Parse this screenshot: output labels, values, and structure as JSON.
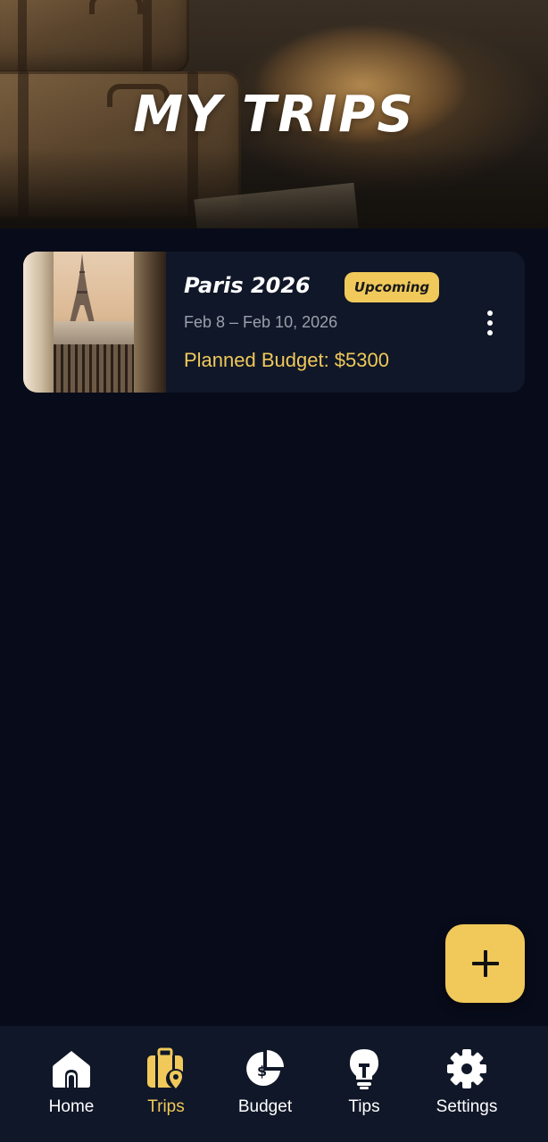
{
  "header": {
    "title": "MY TRIPS"
  },
  "trips": [
    {
      "title": "Paris 2026",
      "status": "Upcoming",
      "dates": "Feb 8 – Feb 10, 2026",
      "budget": "Planned Budget: $5300"
    }
  ],
  "fab": {
    "icon": "plus-icon"
  },
  "nav": {
    "items": [
      {
        "label": "Home",
        "icon": "home-icon",
        "active": false
      },
      {
        "label": "Trips",
        "icon": "luggage-location-icon",
        "active": true
      },
      {
        "label": "Budget",
        "icon": "budget-pie-icon",
        "active": false
      },
      {
        "label": "Tips",
        "icon": "lightbulb-icon",
        "active": false
      },
      {
        "label": "Settings",
        "icon": "gear-icon",
        "active": false
      }
    ]
  },
  "colors": {
    "background": "#080b19",
    "card": "#101728",
    "accent": "#f0c95a",
    "muted_text": "#9aa0ab",
    "text": "#ffffff"
  }
}
